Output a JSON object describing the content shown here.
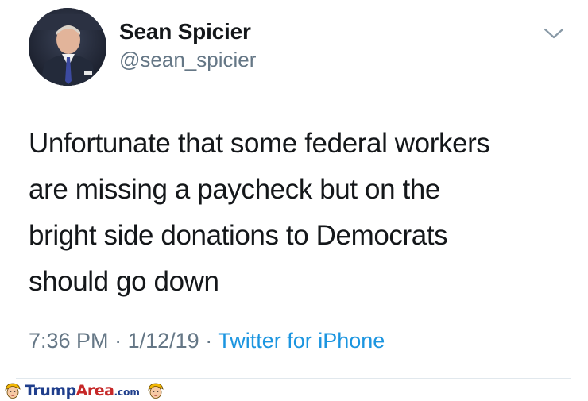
{
  "tweet": {
    "author": {
      "display_name": "Sean Spicier",
      "handle": "@sean_spicier",
      "avatar": "avatar-photo"
    },
    "text_lines": [
      "Unfortunate that some federal workers",
      "are missing a paycheck but on the",
      "bright side donations to Democrats",
      "should go down"
    ],
    "time": "7:36 PM",
    "separator": "·",
    "date": "1/12/19",
    "source": "Twitter for iPhone",
    "menu_icon": "chevron-down-icon"
  },
  "watermark": {
    "brand_part1": "Trump",
    "brand_part2": "Area",
    "brand_suffix": ".com",
    "icon": "cartoon-head-icon"
  },
  "colors": {
    "text_primary": "#14171a",
    "text_secondary": "#657786",
    "link": "#1b95e0",
    "divider": "#e1e8ed",
    "watermark_blue": "#1f3e8c",
    "watermark_red": "#c62828"
  }
}
